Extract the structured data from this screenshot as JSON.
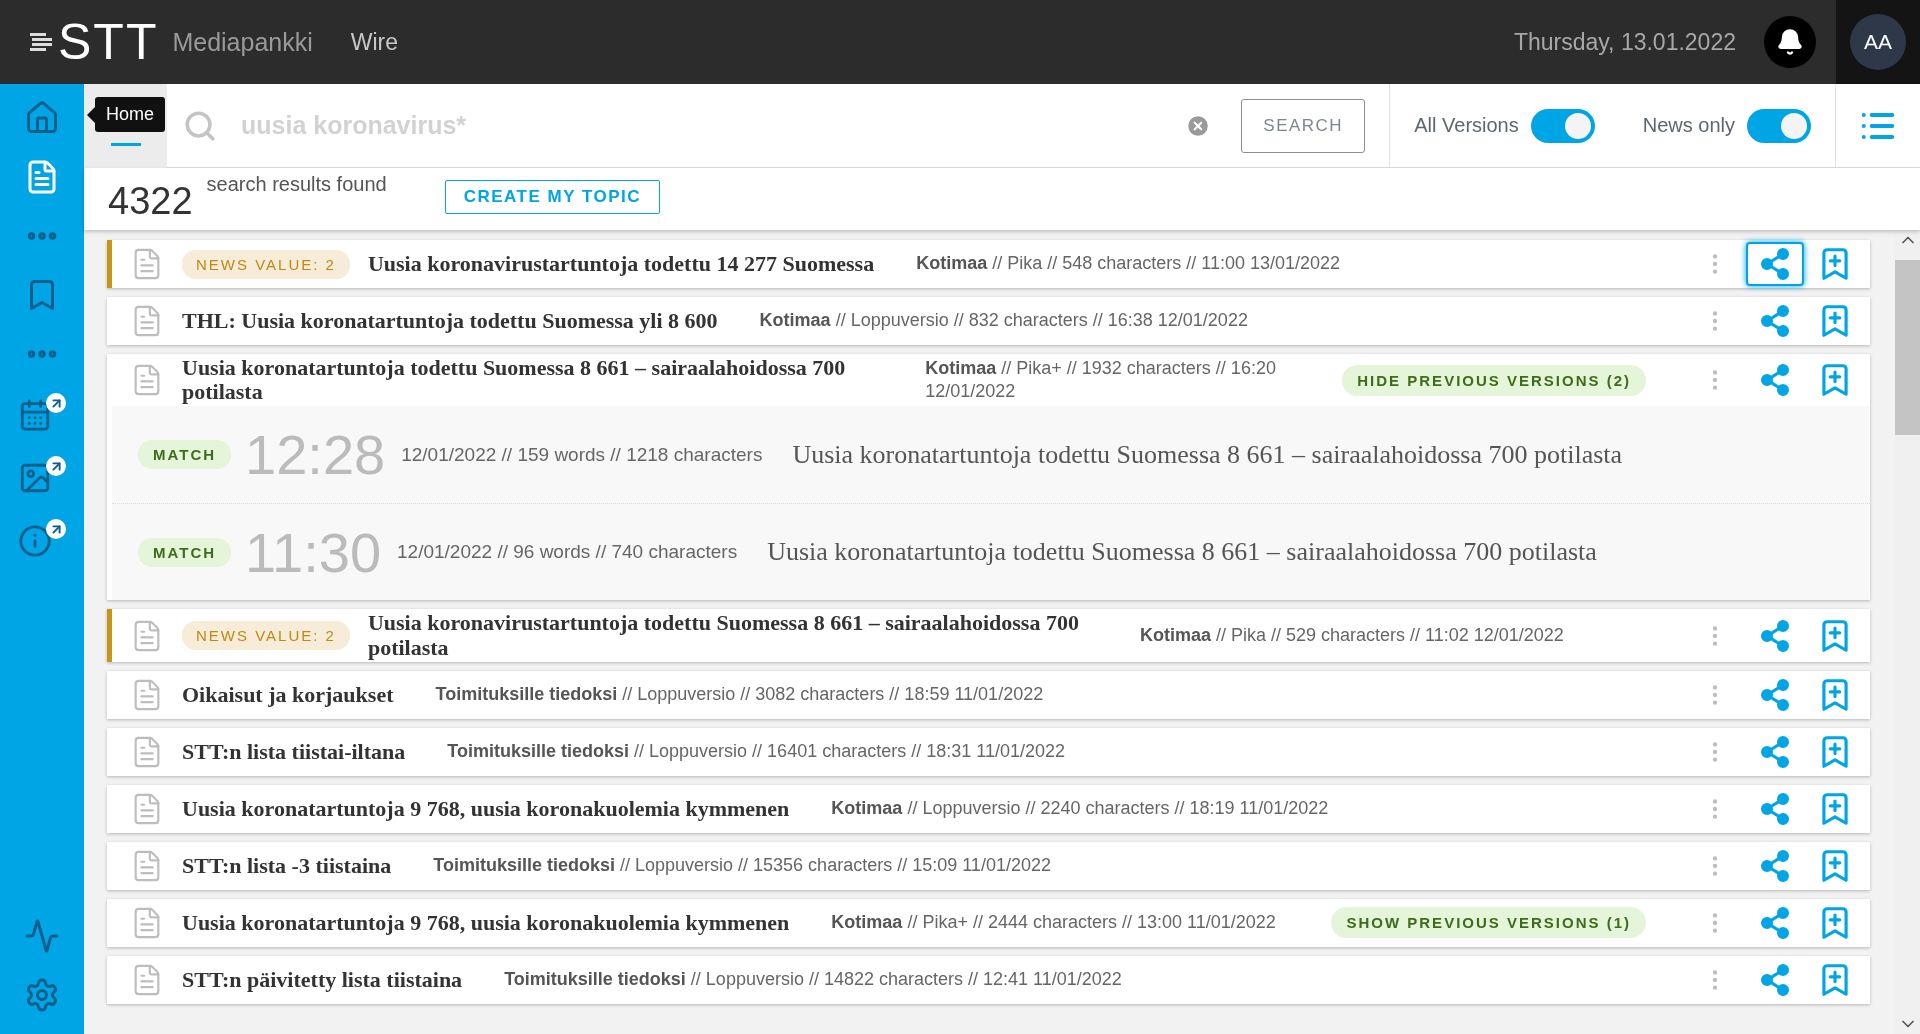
{
  "header": {
    "logo": "STT",
    "product": "Mediapankki",
    "section": "Wire",
    "date": "Thursday, 13.01.2022",
    "avatar": "AA"
  },
  "sidebar": {
    "tooltip": "Home"
  },
  "search": {
    "placeholder": "uusia koronavirus*",
    "button": "SEARCH",
    "toggles": [
      {
        "label": "All Versions",
        "on": true
      },
      {
        "label": "News only",
        "on": true
      }
    ]
  },
  "results": {
    "count": "4322",
    "label": "search results found",
    "create_button": "CREATE MY TOPIC"
  },
  "items": [
    {
      "news_value": "NEWS VALUE: 2",
      "title": "Uusia koronavirustartuntoja todettu 14 277 Suomessa",
      "category": "Kotimaa",
      "details": "// Pika // 548 characters // 11:00 13/01/2022",
      "share_focused": true
    },
    {
      "title": "THL: Uusia koronatartuntoja todettu Suomessa yli 8 600",
      "category": "Kotimaa",
      "details": "// Loppuversio // 832 characters // 16:38 12/01/2022",
      "share_focused": false
    },
    {
      "title": "Uusia koronatartuntoja todettu Suomessa 8 661 – sairaalahoidossa 700 potilasta",
      "category": "Kotimaa",
      "details": "// Pika+ // 1932 characters // 16:20 12/01/2022",
      "share_focused": false,
      "versions_button": "HIDE PREVIOUS VERSIONS (2)",
      "versions": [
        {
          "badge": "MATCH",
          "time": "12:28",
          "details": "12/01/2022 // 159 words // 1218 characters",
          "title": "Uusia koronatartuntoja todettu Suomessa 8 661 – sairaalahoidossa 700 potilasta"
        },
        {
          "badge": "MATCH",
          "time": "11:30",
          "details": "12/01/2022 // 96 words // 740 characters",
          "title": "Uusia koronatartuntoja todettu Suomessa 8 661 – sairaalahoidossa 700 potilasta"
        }
      ]
    },
    {
      "news_value": "NEWS VALUE: 2",
      "title": "Uusia koronavirustartuntoja todettu Suomessa 8 661 – sairaalahoidossa 700 potilasta",
      "category": "Kotimaa",
      "details": "// Pika // 529 characters // 11:02 12/01/2022",
      "share_focused": false
    },
    {
      "title": "Oikaisut ja korjaukset",
      "category": "Toimituksille tiedoksi",
      "details": "// Loppuversio // 3082 characters // 18:59 11/01/2022",
      "share_focused": false
    },
    {
      "title": "STT:n lista tiistai-iltana",
      "category": "Toimituksille tiedoksi",
      "details": "// Loppuversio // 16401 characters // 18:31 11/01/2022",
      "share_focused": false
    },
    {
      "title": "Uusia koronatartuntoja 9 768, uusia koronakuolemia kymmenen",
      "category": "Kotimaa",
      "details": "// Loppuversio // 2240 characters // 18:19 11/01/2022",
      "share_focused": false
    },
    {
      "title": "STT:n lista -3 tiistaina",
      "category": "Toimituksille tiedoksi",
      "details": "// Loppuversio // 15356 characters // 15:09 11/01/2022",
      "share_focused": false
    },
    {
      "title": "Uusia koronatartuntoja 9 768, uusia koronakuolemia kymmenen",
      "category": "Kotimaa",
      "details": "// Pika+ // 2444 characters // 13:00 11/01/2022",
      "share_focused": false,
      "versions_button": "SHOW PREVIOUS VERSIONS (1)"
    },
    {
      "title": "STT:n päivitetty lista tiistaina",
      "category": "Toimituksille tiedoksi",
      "details": "// Loppuversio // 14822 characters // 12:41 11/01/2022",
      "share_focused": false
    }
  ]
}
